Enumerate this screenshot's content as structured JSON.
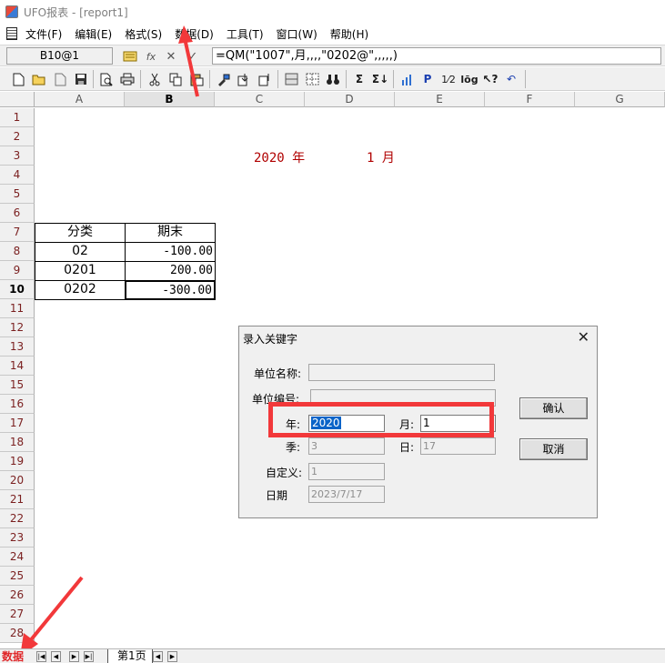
{
  "window": {
    "title": "UFO报表 - [report1]"
  },
  "menu": {
    "items": [
      {
        "label": "文件(F)"
      },
      {
        "label": "编辑(E)"
      },
      {
        "label": "格式(S)"
      },
      {
        "label": "数据(D)"
      },
      {
        "label": "工具(T)"
      },
      {
        "label": "窗口(W)"
      },
      {
        "label": "帮助(H)"
      }
    ]
  },
  "formula_bar": {
    "cell_ref": "B10@1",
    "fx_symbol": "fx",
    "cancel_symbol": "✕",
    "confirm_symbol": "✓",
    "formula": "=QM(\"1007\",月,,,,\"0202@\",,,,,)"
  },
  "grid": {
    "columns": [
      "A",
      "B",
      "C",
      "D",
      "E",
      "F",
      "G"
    ],
    "selected_column": "B",
    "rows": [
      "1",
      "2",
      "3",
      "4",
      "5",
      "6",
      "7",
      "8",
      "9",
      "10",
      "11",
      "12",
      "13",
      "14",
      "15",
      "16",
      "17",
      "18",
      "19",
      "20",
      "21",
      "22",
      "23",
      "24",
      "25",
      "26",
      "27",
      "28"
    ],
    "selected_row": "10"
  },
  "report": {
    "year_label": "2020 年",
    "month_label": "1 月",
    "table": {
      "headers": [
        "分类",
        "期末"
      ],
      "rows": [
        {
          "category": "02",
          "value": "-100.00"
        },
        {
          "category": "0201",
          "value": "200.00"
        },
        {
          "category": "0202",
          "value": "-300.00"
        }
      ]
    }
  },
  "dialog": {
    "title": "录入关键字",
    "close_symbol": "✕",
    "unit_name_label": "单位名称:",
    "unit_name_value": "",
    "unit_code_label": "单位编号:",
    "unit_code_value": "",
    "year_label": "年:",
    "year_value": "2020",
    "month_label": "月:",
    "month_value": "1",
    "quarter_label": "季:",
    "quarter_value": "3",
    "day_label": "日:",
    "day_value": "17",
    "custom_label": "自定义:",
    "custom_value": "1",
    "date_label": "日期",
    "date_value": "2023/7/17",
    "ok_label": "确认",
    "cancel_label": "取消"
  },
  "sheetbar": {
    "status_text": "数据",
    "sheet_tab": "第1页"
  },
  "colors": {
    "accent_red": "#f2383a",
    "report_text_red": "#b00000",
    "row_header_text": "#7a1f1f",
    "selection_blue": "#0a64c8"
  }
}
